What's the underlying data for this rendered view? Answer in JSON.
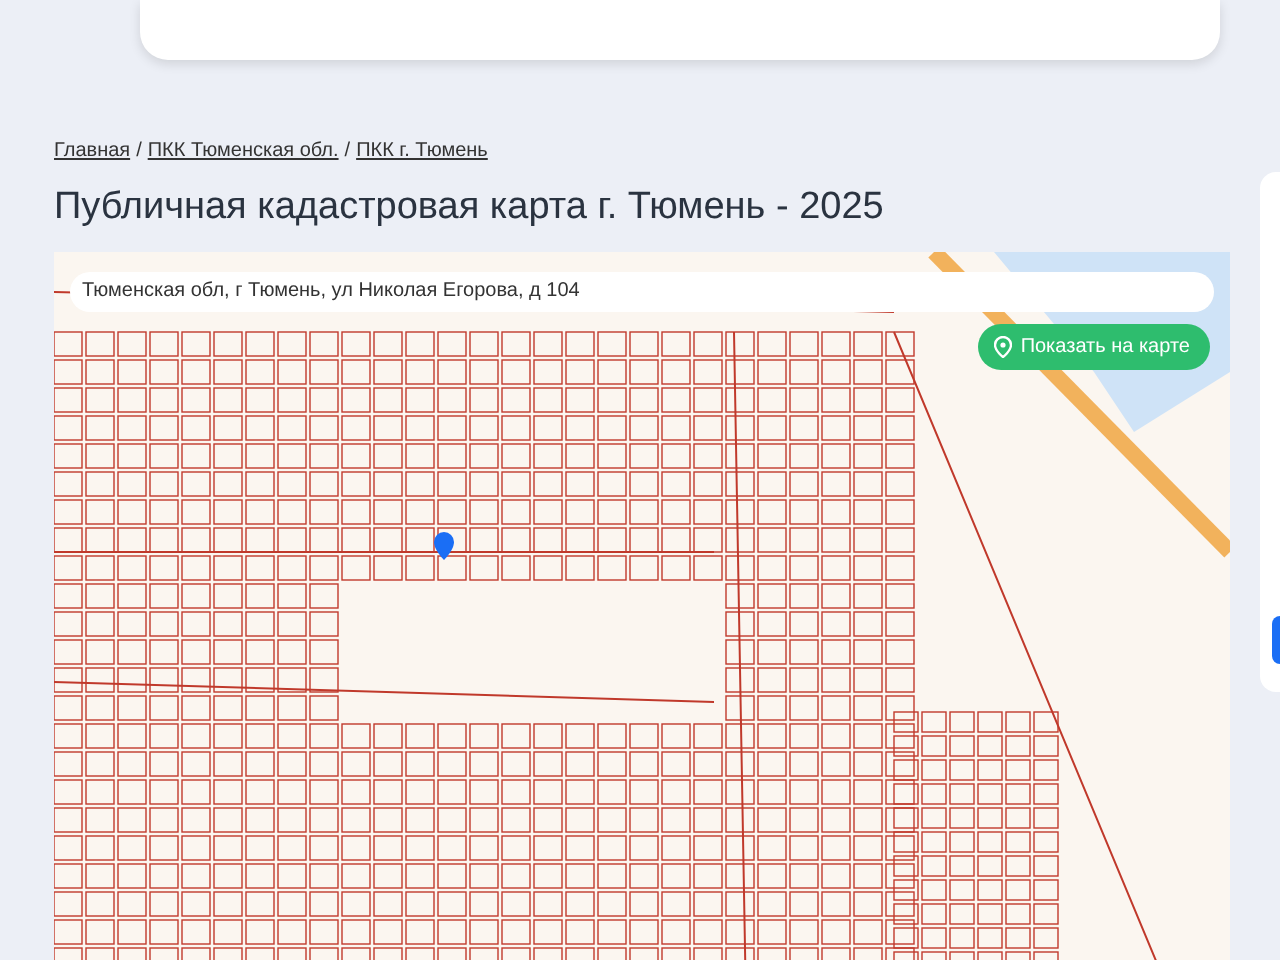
{
  "breadcrumb_separator": "/",
  "breadcrumbs": [
    {
      "label": "Главная"
    },
    {
      "label": "ПКК Тюменская обл."
    },
    {
      "label": "ПКК г. Тюмень"
    }
  ],
  "title": "Публичная кадастровая карта г. Тюмень - 2025",
  "map": {
    "address": "Тюменская обл, г Тюмень, ул Николая Егорова, д 104",
    "show_button": "Показать на карте"
  }
}
